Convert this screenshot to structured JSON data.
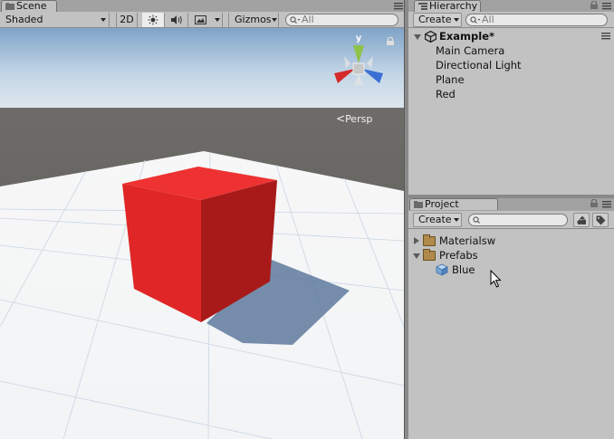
{
  "scene": {
    "tab_label": "Scene",
    "toolbar": {
      "draw_mode": "Shaded",
      "mode_2d": "2D",
      "gizmos_label": "Gizmos",
      "search_placeholder": "All"
    },
    "gizmo": {
      "y_axis_label": "y",
      "projection_label": "Persp"
    }
  },
  "hierarchy": {
    "tab_label": "Hierarchy",
    "create_label": "Create",
    "search_placeholder": "All",
    "scene_name": "Example*",
    "items": [
      {
        "label": "Main Camera"
      },
      {
        "label": "Directional Light"
      },
      {
        "label": "Plane"
      },
      {
        "label": "Red"
      }
    ]
  },
  "project": {
    "tab_label": "Project",
    "create_label": "Create",
    "search_placeholder": "",
    "tree": [
      {
        "label": "Materialsw",
        "type": "folder",
        "expanded": false
      },
      {
        "label": "Prefabs",
        "type": "folder",
        "expanded": true
      },
      {
        "label": "Blue",
        "type": "prefab"
      }
    ]
  },
  "colors": {
    "cube": "#e02626",
    "panel": "#c2c2c2",
    "editor_bg": "#a2a2a2",
    "x_axis": "#d42a2a",
    "y_axis": "#8fc24a",
    "z_axis": "#3b6fd4"
  }
}
